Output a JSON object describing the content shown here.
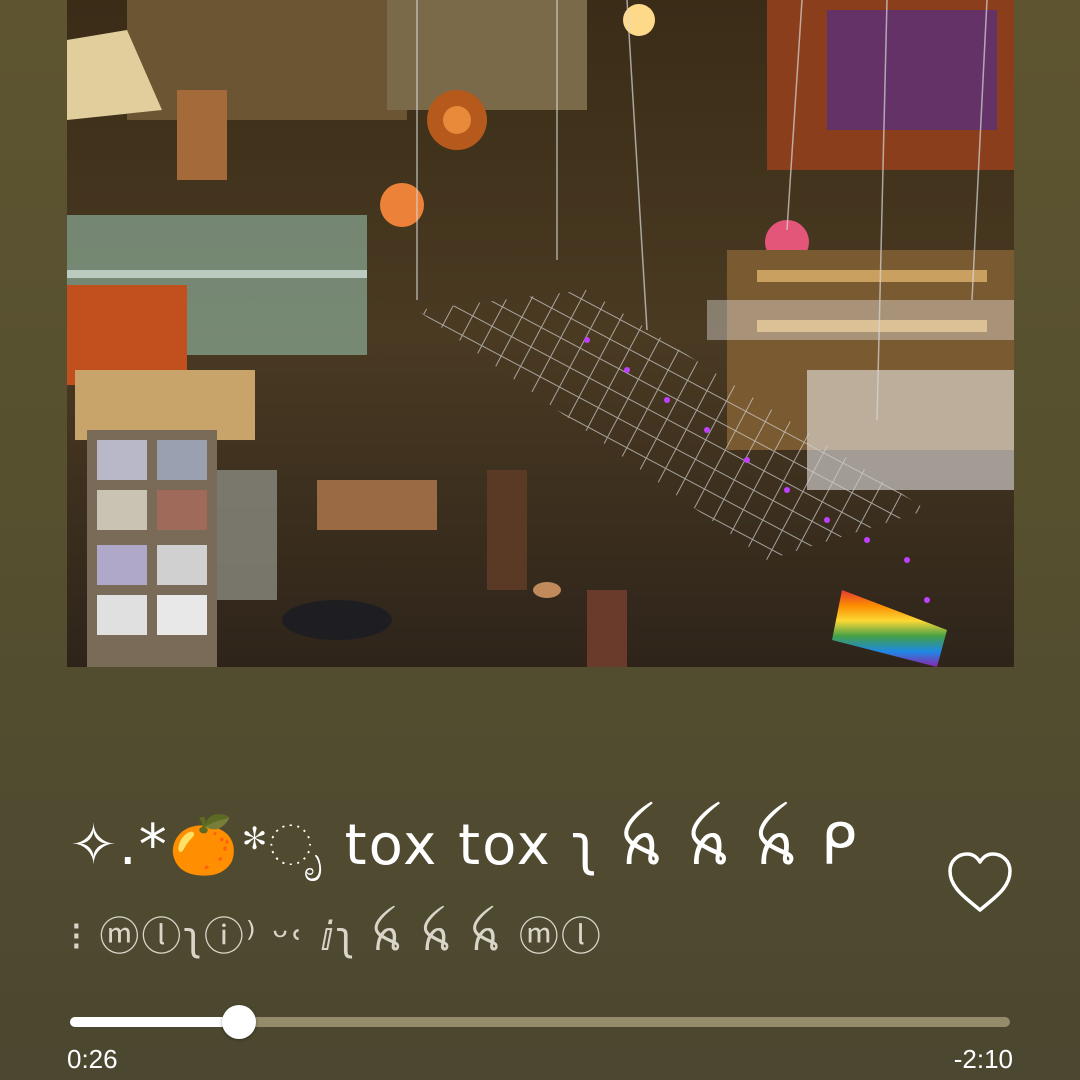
{
  "track": {
    "title": "✧.*🍊*ೃ tox tox ʅ ꫝ ꫝ ꫝ ᑭ",
    "artist": "⁝ ⓜⓛʅⓘ⁾ ᵕ˓ ⅈʅ ꫝ ꫝ ꫝ ⓜⓛ",
    "liked": false
  },
  "player": {
    "elapsed": "0:26",
    "remaining": "-2:10",
    "progress_fraction": 0.18
  },
  "icons": {
    "like": "heart-outline-icon"
  },
  "colors": {
    "background": "#56502f",
    "progress_fill": "#ffffff",
    "progress_track": "#948b6a",
    "text_primary": "#ffffff"
  }
}
